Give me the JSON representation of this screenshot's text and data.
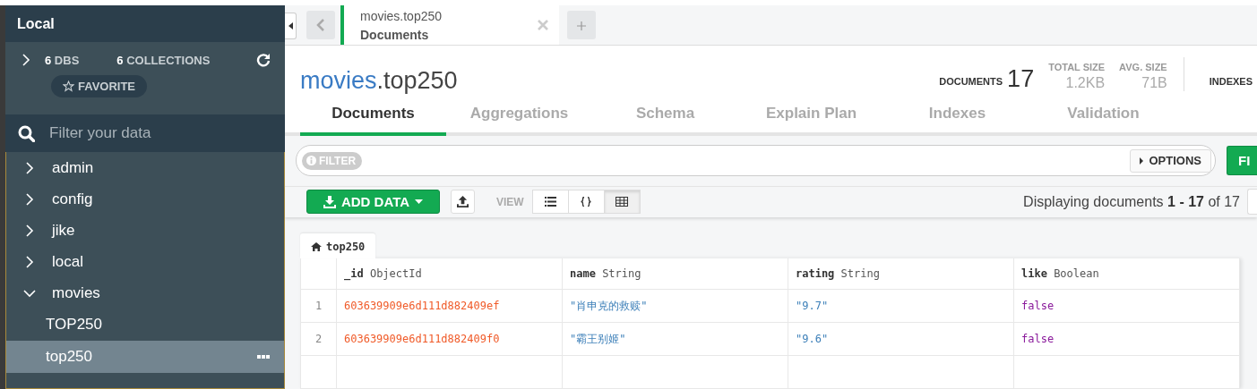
{
  "sidebar": {
    "title": "Local",
    "stats": [
      {
        "value": "6",
        "label": "DBS"
      },
      {
        "value": "6",
        "label": "COLLECTIONS"
      }
    ],
    "favorite": "FAVORITE",
    "search": {
      "placeholder": "Filter your data"
    },
    "databases": [
      {
        "name": "admin",
        "expanded": false
      },
      {
        "name": "config",
        "expanded": false
      },
      {
        "name": "jike",
        "expanded": false
      },
      {
        "name": "local",
        "expanded": false
      },
      {
        "name": "movies",
        "expanded": true,
        "children": [
          {
            "name": "TOP250",
            "selected": false
          },
          {
            "name": "top250",
            "selected": true
          }
        ]
      }
    ]
  },
  "workspace_tab": {
    "namespace": "movies.top250",
    "view": "Documents"
  },
  "header": {
    "database": "movies",
    "collection": ".top250",
    "stats": [
      {
        "label": "DOCUMENTS",
        "value": "17",
        "kind": "primary"
      },
      {
        "label": "TOTAL SIZE",
        "value": "1.2KB",
        "kind": "secondary"
      },
      {
        "label": "AVG. SIZE",
        "value": "71B",
        "kind": "secondary"
      },
      {
        "label": "INDEXES",
        "kind": "primary"
      }
    ]
  },
  "tabs": [
    {
      "label": "Documents",
      "selected": true
    },
    {
      "label": "Aggregations",
      "selected": false
    },
    {
      "label": "Schema",
      "selected": false
    },
    {
      "label": "Explain Plan",
      "selected": false
    },
    {
      "label": "Indexes",
      "selected": false
    },
    {
      "label": "Validation",
      "selected": false
    }
  ],
  "filter": {
    "label": "FILTER",
    "options": "OPTIONS",
    "find": "FI"
  },
  "toolbar": {
    "add_data": "ADD DATA",
    "view_label": "VIEW",
    "views": [
      {
        "kind": "list",
        "selected": false
      },
      {
        "kind": "json",
        "selected": false
      },
      {
        "kind": "table",
        "selected": true
      }
    ],
    "display": "Displaying documents **1 - 17** of 17"
  },
  "table": {
    "tab": "top250",
    "columns": [
      {
        "name": "_id",
        "type": "ObjectId"
      },
      {
        "name": "name",
        "type": "String"
      },
      {
        "name": "rating",
        "type": "String"
      },
      {
        "name": "like",
        "type": "Boolean"
      }
    ],
    "rows": [
      {
        "number": "1",
        "cells": [
          {
            "kind": "objectid",
            "value": "603639909e6d111d882409ef"
          },
          {
            "kind": "string",
            "value": "\"肖申克的救赎\""
          },
          {
            "kind": "string",
            "value": "\"9.7\""
          },
          {
            "kind": "boolean",
            "value": "false"
          }
        ]
      },
      {
        "number": "2",
        "cells": [
          {
            "kind": "objectid",
            "value": "603639909e6d111d882409f0"
          },
          {
            "kind": "string",
            "value": "\"霸王别姬\""
          },
          {
            "kind": "string",
            "value": "\"9.6\""
          },
          {
            "kind": "boolean",
            "value": "false"
          }
        ]
      }
    ]
  }
}
